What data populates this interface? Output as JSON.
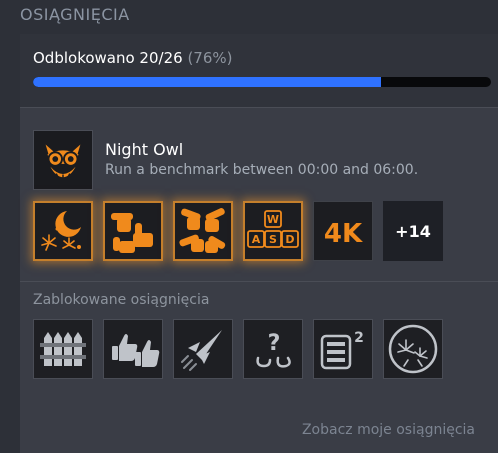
{
  "header": {
    "title": "OSIĄGNIĘCIA"
  },
  "progress": {
    "label": "Odblokowano 20/26",
    "percent_text": "(76%)",
    "fraction": 0.76
  },
  "featured": {
    "icon": "night-owl-icon",
    "title": "Night Owl",
    "description": "Run a benchmark between 00:00 and 06:00."
  },
  "unlocked": {
    "icons": [
      "moon-fireworks-icon",
      "pointing-hands-icon",
      "pointing-fingers-icon",
      "wasd-keys-icon",
      "4k-icon"
    ],
    "badge_4k": "4K",
    "more_label": "+14"
  },
  "keys": {
    "w": "W",
    "a": "A",
    "s": "S",
    "d": "D"
  },
  "locked": {
    "title": "Zablokowane osiągnięcia",
    "icons": [
      "fence-icon",
      "thumbs-up-icon",
      "spaceship-icon",
      "question-hook-icon",
      "squared-list-icon",
      "fireworks-circle-icon"
    ],
    "question_mark": "?",
    "superscript": "2"
  },
  "footer": {
    "link": "Zobacz moje osiągnięcia"
  },
  "colors": {
    "accent": "#2f72ff",
    "gold": "#f08a1c",
    "panel": "#3a3d46",
    "background": "#2d3038"
  }
}
